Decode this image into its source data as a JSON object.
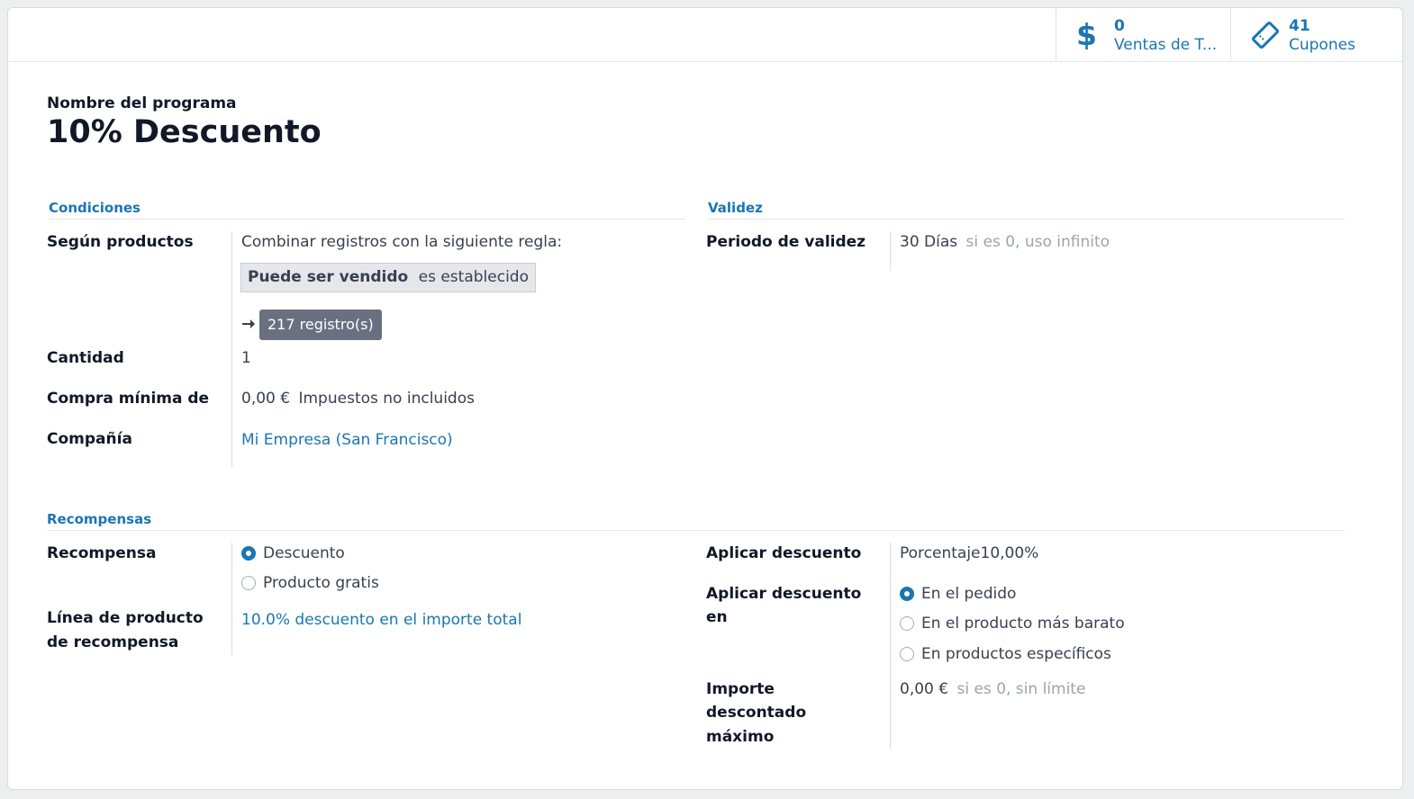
{
  "stats": {
    "ventas": {
      "value": "0",
      "label": "Ventas de T...",
      "icon": "dollar-icon"
    },
    "cupones": {
      "value": "41",
      "label": "Cupones",
      "icon": "ticket-icon"
    }
  },
  "program": {
    "name_label": "Nombre del programa",
    "name": "10% Descuento"
  },
  "conditions": {
    "section_title": "Condiciones",
    "segun_productos_label": "Según productos",
    "rule_intro": "Combinar registros con la siguiente regla:",
    "rule_field": "Puede ser vendido",
    "rule_operator": "es establecido",
    "records_button": "217 registro(s)",
    "cantidad_label": "Cantidad",
    "cantidad_value": "1",
    "compra_minima_label": "Compra mínima de",
    "compra_minima_value": "0,00 €",
    "compra_minima_tax": "Impuestos no incluidos",
    "compania_label": "Compañía",
    "compania_value": "Mi Empresa (San Francisco)"
  },
  "validity": {
    "section_title": "Validez",
    "periodo_label": "Periodo de validez",
    "periodo_value": "30 Días",
    "periodo_hint": "si es 0, uso infinito"
  },
  "rewards": {
    "section_title": "Recompensas",
    "recompensa_label": "Recompensa",
    "recompensa_options": [
      {
        "label": "Descuento",
        "selected": true
      },
      {
        "label": "Producto gratis",
        "selected": false
      }
    ],
    "linea_label_1": "Línea de producto",
    "linea_label_2": "de recompensa",
    "linea_value": "10.0% descuento en el importe total",
    "aplicar_label": "Aplicar descuento",
    "aplicar_value": "Porcentaje10,00%",
    "aplicar_en_label_1": "Aplicar descuento",
    "aplicar_en_label_2": "en",
    "aplicar_en_options": [
      {
        "label": "En el pedido",
        "selected": true
      },
      {
        "label": "En el producto más barato",
        "selected": false
      },
      {
        "label": "En productos específicos",
        "selected": false
      }
    ],
    "importe_label_1": "Importe",
    "importe_label_2": "descontado",
    "importe_label_3": "máximo",
    "importe_value": "0,00 €",
    "importe_hint": "si es 0, sin límite"
  },
  "colors": {
    "accent": "#1a76b3",
    "records_button_bg": "#6b7081",
    "chip_bg": "#e5e7eb"
  }
}
